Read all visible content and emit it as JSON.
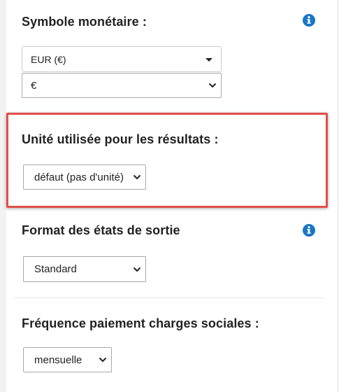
{
  "currency": {
    "heading": "Symbole monétaire :",
    "dropdown_value": "EUR (€)",
    "symbol_value": "€"
  },
  "unit": {
    "heading": "Unité utilisée pour les résultats :",
    "value": "défaut (pas d'unité)"
  },
  "format": {
    "heading": "Format des états de sortie",
    "value": "Standard"
  },
  "frequency": {
    "heading": "Fréquence paiement charges sociales :",
    "value": "mensuelle"
  },
  "colors": {
    "info_icon": "#1a76c7",
    "highlight_border": "#e0504a"
  },
  "icons": {
    "info": "info-circle-icon",
    "caret": "caret-down-icon",
    "chevron": "chevron-down-icon"
  }
}
